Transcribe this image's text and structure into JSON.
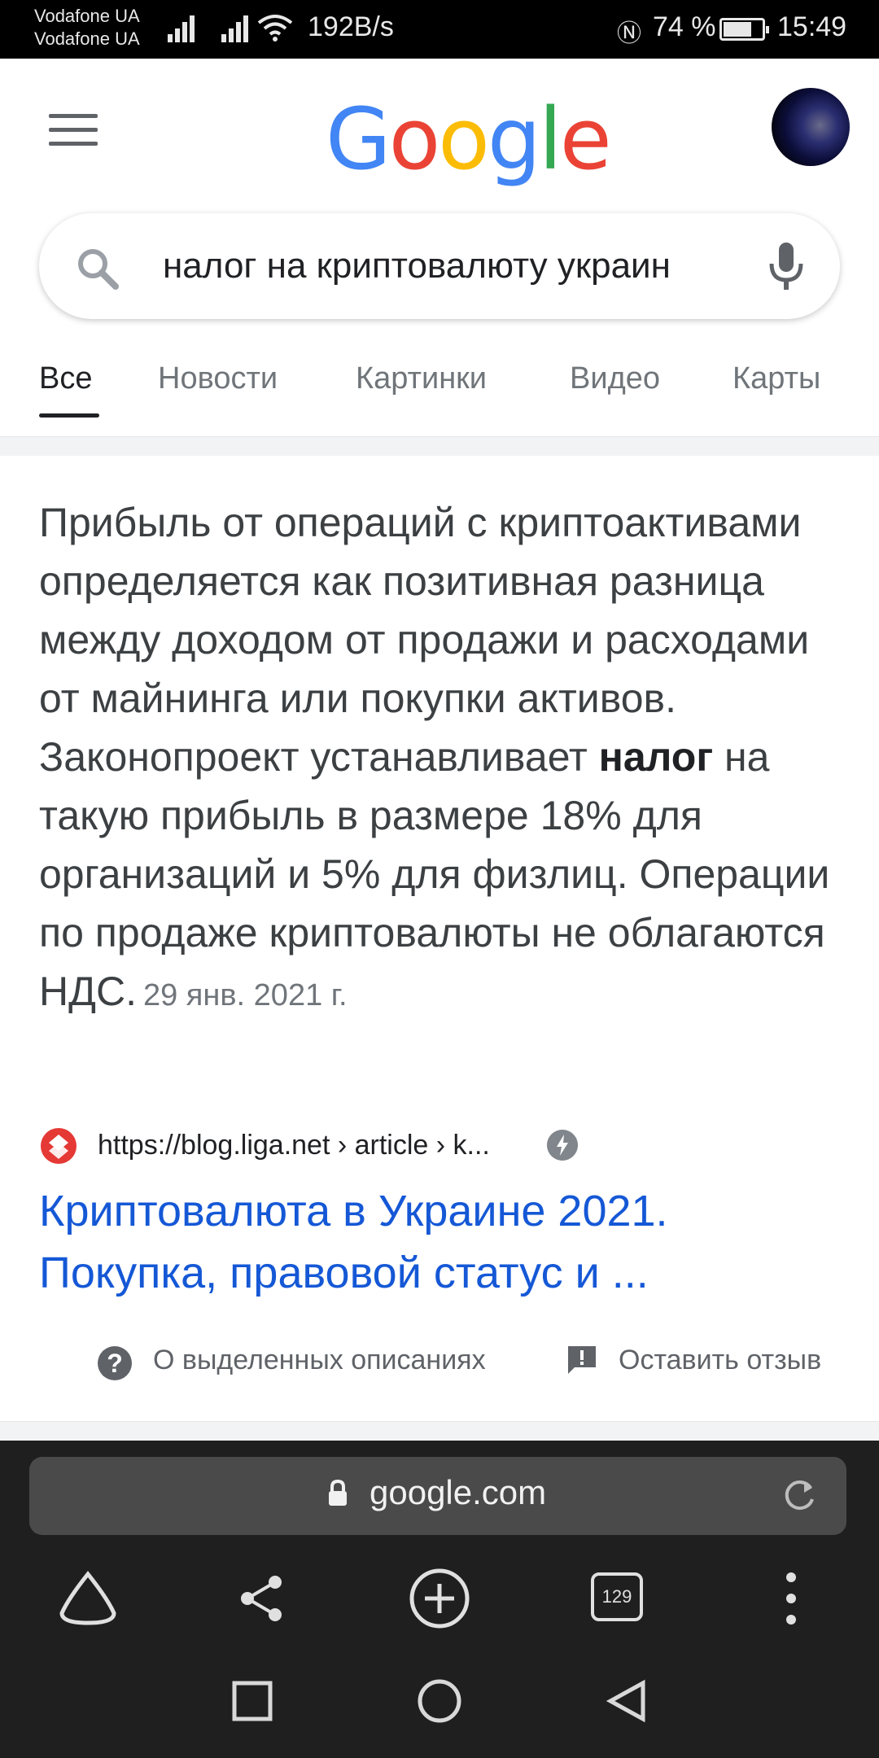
{
  "status_bar": {
    "carrier1": "Vodafone UA",
    "carrier2": "Vodafone UA",
    "speed": "192B/s",
    "battery_percent": "74 %",
    "battery_level": 0.74,
    "time": "15:49"
  },
  "header": {
    "logo": [
      "G",
      "o",
      "o",
      "g",
      "l",
      "e"
    ]
  },
  "search": {
    "query": "налог на криптовалюту украин"
  },
  "tabs": [
    "Все",
    "Новости",
    "Картинки",
    "Видео",
    "Карты"
  ],
  "snippet": {
    "text_before": "Прибыль от операций с криптоактивами определяется как позитивная разница между доходом от продажи и расходами от майнинга или покупки активов. Законопроект устанавливает ",
    "bold": "налог",
    "text_after": " на такую прибыль в размере 18% для организаций и 5% для физлиц. Операции по продаже криптовалюты не облагаются НДС.",
    "date": "29 янв. 2021 г."
  },
  "result": {
    "url": "https://blog.liga.net › article › k...",
    "title": "Криптовалюта в Украине 2021. Покупка, правовой статус и ..."
  },
  "footer": {
    "about_label": "О выделенных описаниях",
    "feedback_label": "Оставить отзыв"
  },
  "browser": {
    "domain": "google.com",
    "tab_count": "129"
  },
  "colors": {
    "google_blue": "#4285F4",
    "google_red": "#EA4335",
    "google_yellow": "#FBBC05",
    "google_green": "#34A853",
    "link_blue": "#1558d6"
  }
}
